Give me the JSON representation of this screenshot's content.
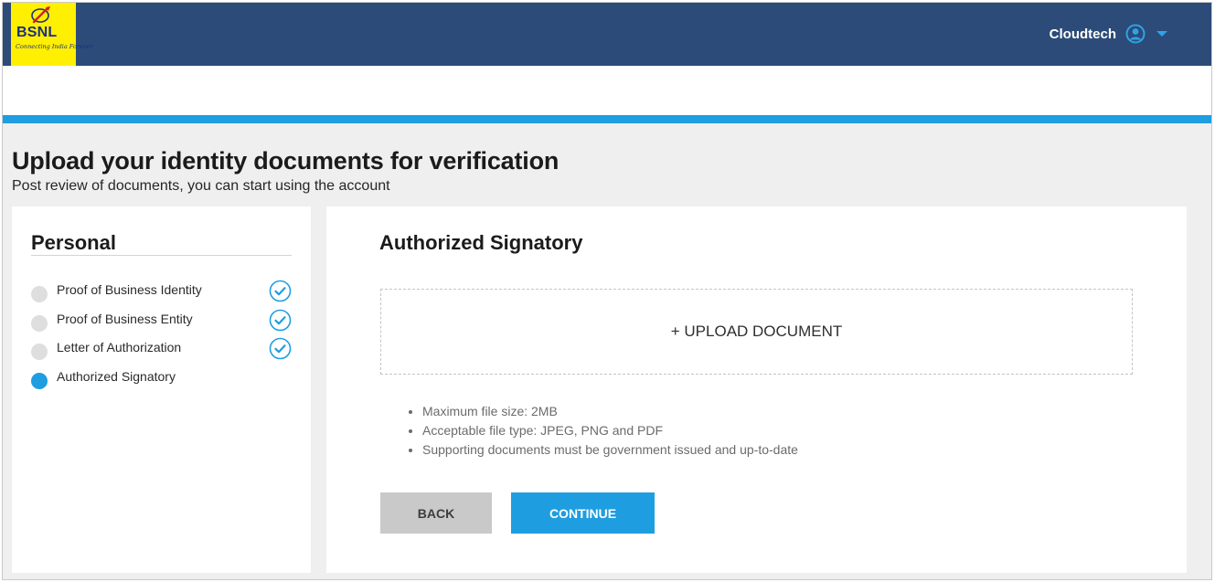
{
  "header": {
    "logo": {
      "brand": "BSNL",
      "tagline": "Connecting India Forever",
      "icon": "bsnl-logo-icon"
    },
    "user": {
      "name": "Cloudtech",
      "avatar_icon": "user-circle-icon",
      "menu_icon": "caret-down-icon"
    }
  },
  "page": {
    "title": "Upload your identity documents for verification",
    "subtitle": "Post review of documents, you can start using the account"
  },
  "sidebar": {
    "title": "Personal",
    "steps": [
      {
        "label": "Proof of Business Identity",
        "completed": true,
        "active": false
      },
      {
        "label": "Proof of Business Entity",
        "completed": true,
        "active": false
      },
      {
        "label": "Letter of Authorization",
        "completed": true,
        "active": false
      },
      {
        "label": "Authorized Signatory",
        "completed": false,
        "active": true
      }
    ]
  },
  "main": {
    "section_title": "Authorized Signatory",
    "upload_label": "+ UPLOAD DOCUMENT",
    "notes": [
      "Maximum file size: 2MB",
      "Acceptable file type: JPEG, PNG and PDF",
      "Supporting documents must be government issued and up-to-date"
    ],
    "back_label": "BACK",
    "continue_label": "CONTINUE"
  },
  "colors": {
    "header_bg": "#2c4b78",
    "accent": "#1e9ee0",
    "logo_bg": "#ffef00",
    "back_button": "#c9c9c9"
  }
}
